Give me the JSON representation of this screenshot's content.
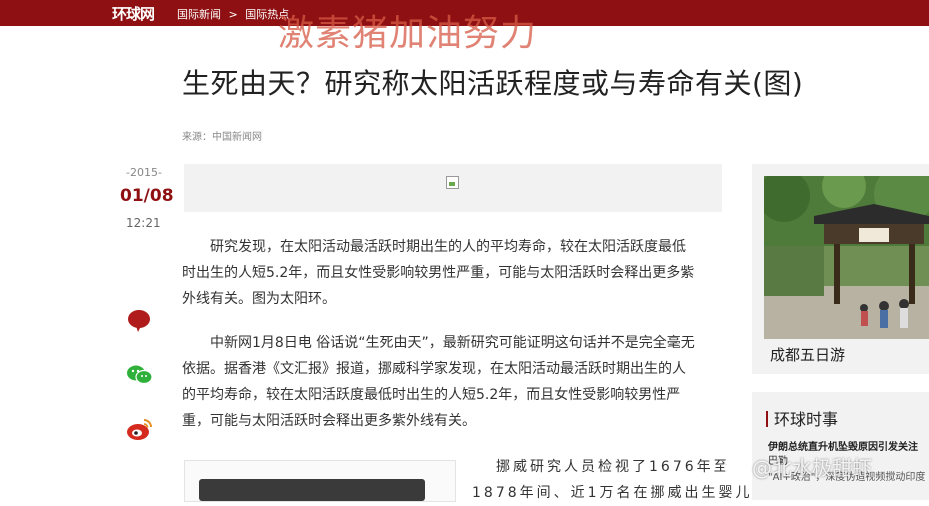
{
  "header": {
    "logo": "环球网",
    "breadcrumb": [
      "国际新闻",
      ">",
      "国际热点"
    ],
    "colors": {
      "bar": "#8e1012"
    }
  },
  "watermark_top": "激素猪加油努力",
  "article": {
    "title": "生死由天？研究称太阳活跃程度或与寿命有关(图)",
    "source": "来源：中国新闻网",
    "date": {
      "year": "-2015-",
      "day": "01/08",
      "time": "12:21"
    },
    "paragraphs": [
      [
        "研究发现，在太阳活动最活跃时期出生的人的平均寿命，较在太阳活跃度最低",
        "时出生的人短5.2年，而且女性受影响较男性严重，可能与太阳活跃时会释出更多紫",
        "外线有关。图为太阳环。"
      ],
      [
        "中新网1月8日电 俗话说“生死由天”，最新研究可能证明这句话并不是完全毫无",
        "依据。据香港《文汇报》报道，挪威科学家发现，在太阳活动最活跃时期出生的人",
        "的平均寿命，较在太阳活跃度最低时出生的人短5.2年，而且女性受影响较男性严",
        "重，可能与太阳活跃时会释出更多紫外线有关。"
      ]
    ],
    "lower_lines": [
      "挪威研究人员检视了1676年至",
      "1878年间、近1万名在挪威出生婴儿的"
    ]
  },
  "share": {
    "icons": [
      "comment-icon",
      "wechat-icon",
      "weibo-icon"
    ],
    "colors": {
      "comment": "#b01c1c",
      "wechat": "#2eb03a",
      "weibo": "#d52b1e"
    }
  },
  "sidebar": {
    "photo_caption": "成都五日游",
    "section_title": "环球时事",
    "lines": [
      "伊朗总统直升机坠毁原因引发关注",
      "巴勒",
      "\"AI+政治\"，深度伪造视频搅动印度"
    ]
  },
  "watermark_bottom": "@北水极甜虾"
}
